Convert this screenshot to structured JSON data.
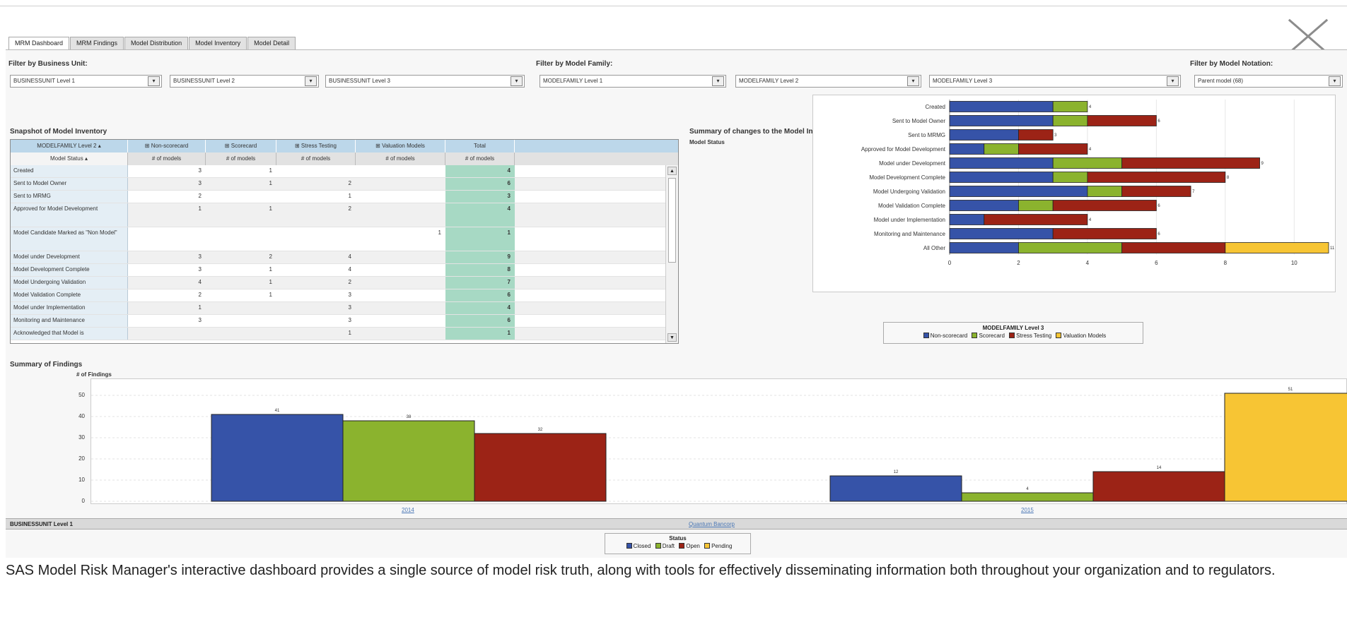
{
  "tabs": [
    "MRM Dashboard",
    "MRM Findings",
    "Model Distribution",
    "Model Inventory",
    "Model Detail"
  ],
  "filters": {
    "business_unit_label": "Filter by Business Unit:",
    "business_unit": [
      "BUSINESSUNIT Level 1",
      "BUSINESSUNIT Level 2",
      "BUSINESSUNIT Level 3"
    ],
    "model_family_label": "Filter by Model Family:",
    "model_family": [
      "MODELFAMILY Level 1",
      "MODELFAMILY Level 2",
      "MODELFAMILY Level 3"
    ],
    "model_notation_label": "Filter by Model Notation:",
    "model_notation": "Parent model (68)",
    "dropdown_arrow": "▾"
  },
  "inventory": {
    "title": "Snapshot of Model Inventory",
    "group_header": "MODELFAMILY Level 2",
    "row_header": "Model Status",
    "columns": [
      "Non-scorecard",
      "Scorecard",
      "Stress Testing",
      "Valuation Models",
      "Total"
    ],
    "measure": "# of models",
    "rows": [
      {
        "label": "Created",
        "values": [
          "3",
          "1",
          "",
          "",
          "4"
        ]
      },
      {
        "label": "Sent to Model Owner",
        "values": [
          "3",
          "1",
          "2",
          "",
          "6"
        ]
      },
      {
        "label": "Sent to MRMG",
        "values": [
          "2",
          "",
          "1",
          "",
          "3"
        ]
      },
      {
        "label": "Approved for Model Development",
        "values": [
          "1",
          "1",
          "2",
          "",
          "4"
        ]
      },
      {
        "label": "Model Candidate Marked as \"Non Model\"",
        "values": [
          "",
          "",
          "",
          "1",
          "1"
        ]
      },
      {
        "label": "Model under Development",
        "values": [
          "3",
          "2",
          "4",
          "",
          "9"
        ]
      },
      {
        "label": "Model Development Complete",
        "values": [
          "3",
          "1",
          "4",
          "",
          "8"
        ]
      },
      {
        "label": "Model Undergoing Validation",
        "values": [
          "4",
          "1",
          "2",
          "",
          "7"
        ]
      },
      {
        "label": "Model Validation Complete",
        "values": [
          "2",
          "1",
          "3",
          "",
          "6"
        ]
      },
      {
        "label": "Model under Implementation",
        "values": [
          "1",
          "",
          "3",
          "",
          "4"
        ]
      },
      {
        "label": "Monitoring and Maintenance",
        "values": [
          "3",
          "",
          "3",
          "",
          "6"
        ]
      },
      {
        "label": "Acknowledged that Model is",
        "values": [
          "",
          "",
          "1",
          "",
          "1"
        ]
      }
    ]
  },
  "changes": {
    "title": "Summary of changes to the Model Inventory",
    "ylabel": "Model Status",
    "legend_title": "MODELFAMILY Level 3"
  },
  "findings": {
    "title": "Summary of Findings",
    "ylabel": "# of Findings",
    "bu_label": "BUSINESSUNIT Level 1",
    "bu_value": "Quantum Bancorp",
    "legend_title": "Status"
  },
  "colors": {
    "blue": "#3653a8",
    "green": "#8bb32e",
    "red": "#9c2316",
    "yellow": "#f7c534"
  },
  "chart_data": [
    {
      "type": "bar",
      "orientation": "horizontal",
      "stacked": true,
      "categories": [
        "Created",
        "Sent to Model Owner",
        "Sent to MRMG",
        "Approved for Model Development",
        "Model under Development",
        "Model Development Complete",
        "Model Undergoing Validation",
        "Model Validation Complete",
        "Model under Implementation",
        "Monitoring and Maintenance",
        "All Other"
      ],
      "series": [
        {
          "name": "Non-scorecard",
          "color": "#3653a8",
          "values": [
            3,
            3,
            2,
            1,
            3,
            3,
            4,
            2,
            1,
            3,
            2
          ]
        },
        {
          "name": "Scorecard",
          "color": "#8bb32e",
          "values": [
            1,
            1,
            0,
            1,
            2,
            1,
            1,
            1,
            0,
            0,
            3
          ]
        },
        {
          "name": "Stress Testing",
          "color": "#9c2316",
          "values": [
            0,
            2,
            1,
            2,
            4,
            4,
            2,
            3,
            3,
            3,
            3
          ]
        },
        {
          "name": "Valuation Models",
          "color": "#f7c534",
          "values": [
            0,
            0,
            0,
            0,
            0,
            0,
            0,
            0,
            0,
            0,
            3
          ]
        }
      ],
      "totals": [
        "4",
        "6",
        "3",
        "4",
        "9",
        "8",
        "7",
        "6",
        "4",
        "6",
        "11"
      ],
      "xlim": [
        0,
        11
      ],
      "xticks": [
        "0",
        "2",
        "4",
        "6",
        "8",
        "10"
      ],
      "ylabel": "Model Status",
      "legend_title": "MODELFAMILY Level 3",
      "legend_position": "bottom",
      "grid": true
    },
    {
      "type": "bar",
      "categories": [
        "2014",
        "2015"
      ],
      "series": [
        {
          "name": "Closed",
          "color": "#3653a8",
          "values": [
            41,
            12
          ]
        },
        {
          "name": "Draft",
          "color": "#8bb32e",
          "values": [
            38,
            4
          ]
        },
        {
          "name": "Open",
          "color": "#9c2316",
          "values": [
            32,
            14
          ]
        },
        {
          "name": "Pending",
          "color": "#f7c534",
          "values": [
            0,
            51
          ]
        }
      ],
      "value_labels": [
        [
          "41",
          "38",
          "32",
          ""
        ],
        [
          "12",
          "4",
          "14",
          "51"
        ]
      ],
      "ylim": [
        0,
        55
      ],
      "yticks": [
        "0",
        "10",
        "20",
        "30",
        "40",
        "50"
      ],
      "ylabel": "# of Findings",
      "legend_title": "Status",
      "legend_position": "bottom",
      "grid": true
    }
  ],
  "caption": "SAS Model Risk Manager's interactive dashboard provides a single source of model risk truth, along with tools for effectively disseminating information both throughout your organization and to regulators."
}
